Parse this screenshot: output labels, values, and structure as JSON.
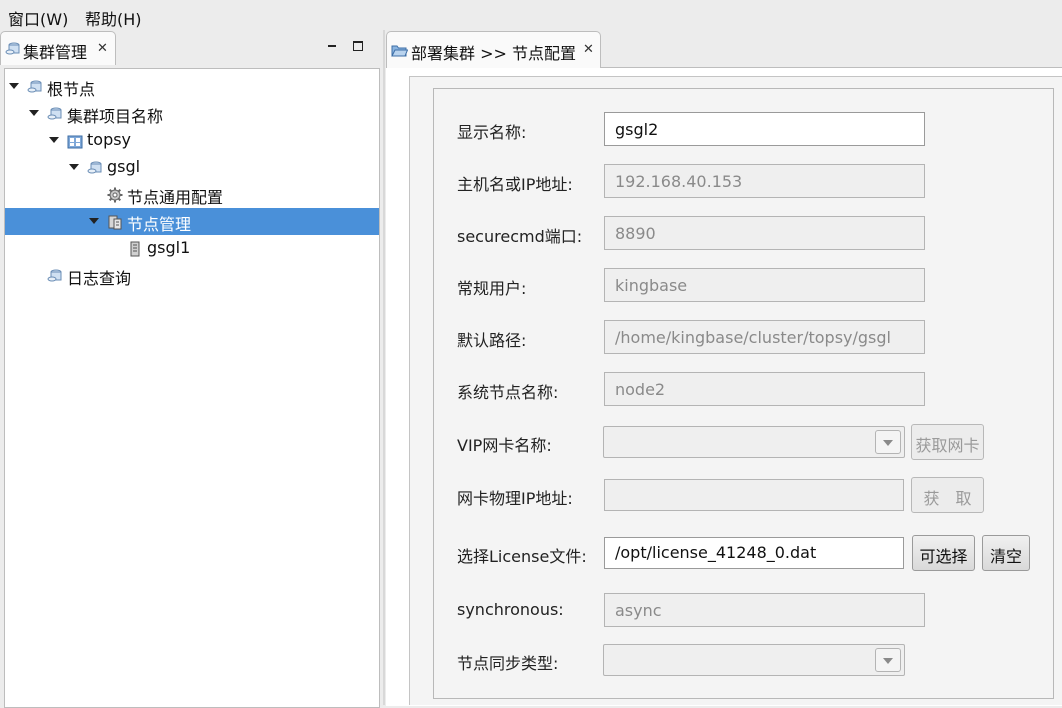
{
  "menubar": {
    "items": [
      {
        "label": "窗口(W)"
      },
      {
        "label": "帮助(H)"
      }
    ]
  },
  "left_view": {
    "tab_title": "集群管理",
    "tree": [
      {
        "label": "根节点",
        "icon": "cluster-icon"
      },
      {
        "label": "集群项目名称",
        "icon": "cluster-icon"
      },
      {
        "label": "topsy",
        "icon": "project-icon"
      },
      {
        "label": "gsgl",
        "icon": "cluster-icon"
      },
      {
        "label": "节点通用配置",
        "icon": "gear-icon"
      },
      {
        "label": "节点管理",
        "icon": "node-manage-icon",
        "selected": true
      },
      {
        "label": "gsgl1",
        "icon": "server-icon"
      },
      {
        "label": "日志查询",
        "icon": "cluster-icon"
      }
    ]
  },
  "editor": {
    "tab_title": "部署集群 >> 节点配置",
    "form": {
      "display_name": {
        "label": "显示名称:",
        "value": "gsgl2"
      },
      "host_ip": {
        "label": "主机名或IP地址:",
        "value": "192.168.40.153"
      },
      "securecmd_port": {
        "label": "securecmd端口:",
        "value": "8890"
      },
      "normal_user": {
        "label": "常规用户:",
        "value": "kingbase"
      },
      "default_path": {
        "label": "默认路径:",
        "value": "/home/kingbase/cluster/topsy/gsgl"
      },
      "system_node_name": {
        "label": "系统节点名称:",
        "value": "node2"
      },
      "vip_nic_name": {
        "label": "VIP网卡名称:",
        "value": "",
        "button": "获取网卡"
      },
      "nic_physical_ip": {
        "label": "网卡物理IP地址:",
        "value": "",
        "button": "获　取"
      },
      "license_file": {
        "label": "选择License文件:",
        "value": "/opt/license_41248_0.dat",
        "choose_button": "可选择",
        "clear_button": "清空"
      },
      "synchronous": {
        "label": "synchronous:",
        "value": "async"
      },
      "node_sync_type": {
        "label": "节点同步类型:",
        "value": ""
      }
    }
  }
}
